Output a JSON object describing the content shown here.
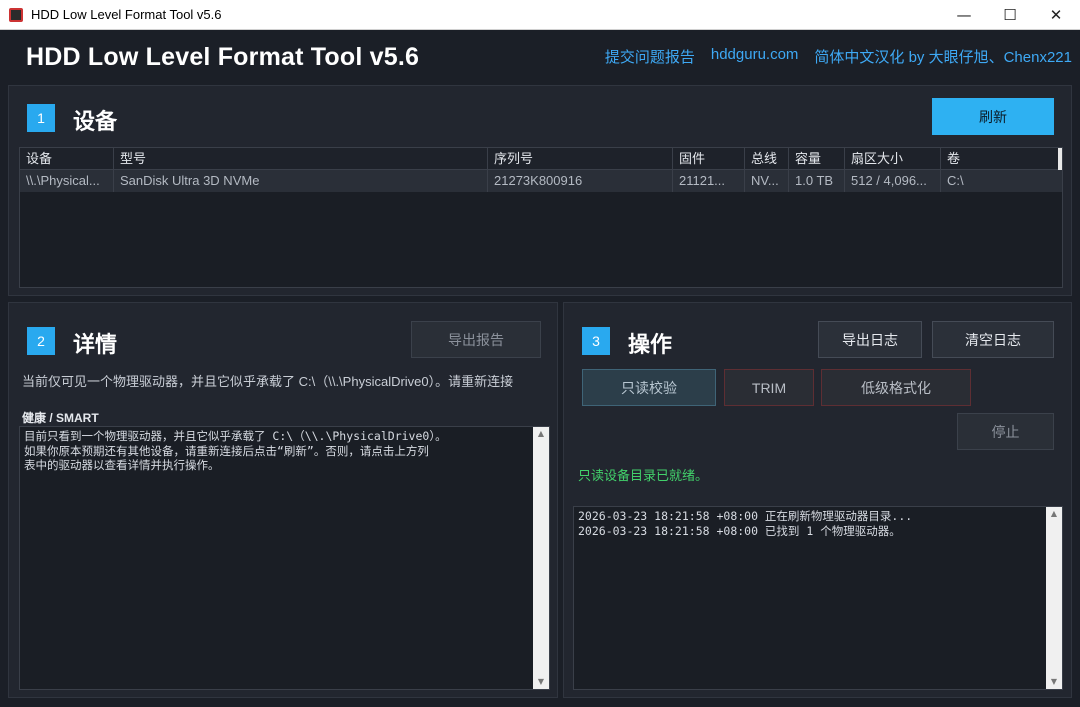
{
  "window": {
    "title": "HDD Low Level Format Tool v5.6",
    "controls": [
      "—",
      "☐",
      "✕"
    ]
  },
  "header": {
    "app_title": "HDD Low Level Format Tool v5.6",
    "links": [
      "提交问题报告",
      "hddguru.com",
      "简体中文汉化 by 大眼仔旭、Chenx221"
    ]
  },
  "colors": {
    "accent": "#2eb1f2",
    "link": "#3ea9f5",
    "status_ok": "#42d26b",
    "background": "#1b1f27"
  },
  "devices": {
    "step": "1",
    "title": "设备",
    "refresh_label": "刷新",
    "columns": [
      "设备",
      "型号",
      "序列号",
      "固件",
      "总线",
      "容量",
      "扇区大小",
      "卷"
    ],
    "rows": [
      [
        "\\\\.\\Physical...",
        "SanDisk Ultra 3D NVMe",
        "21273K800916",
        "21121...",
        "NV...",
        "1.0 TB",
        "512 / 4,096...",
        "C:\\"
      ]
    ]
  },
  "details": {
    "step": "2",
    "title": "详情",
    "export_report_label": "导出报告",
    "info": "当前仅可见一个物理驱动器，并且它似乎承载了 C:\\（\\\\.\\PhysicalDrive0）。请重新连接",
    "smart_label": "健康 / SMART",
    "smart_lines": [
      "目前只看到一个物理驱动器，并且它似乎承载了 C:\\（\\\\.\\PhysicalDrive0）。",
      "如果你原本预期还有其他设备，请重新连接后点击“刷新”。否则，请点击上方列",
      "表中的驱动器以查看详情并执行操作。"
    ]
  },
  "operations": {
    "step": "3",
    "title": "操作",
    "export_log_label": "导出日志",
    "clear_log_label": "清空日志",
    "verify_label": "只读校验",
    "trim_label": "TRIM",
    "format_label": "低级格式化",
    "stop_label": "停止",
    "status": "只读设备目录已就绪。",
    "log_lines": [
      "2026-03-23 18:21:58 +08:00  正在刷新物理驱动器目录...",
      "2026-03-23 18:21:58 +08:00  已找到 1 个物理驱动器。"
    ]
  }
}
